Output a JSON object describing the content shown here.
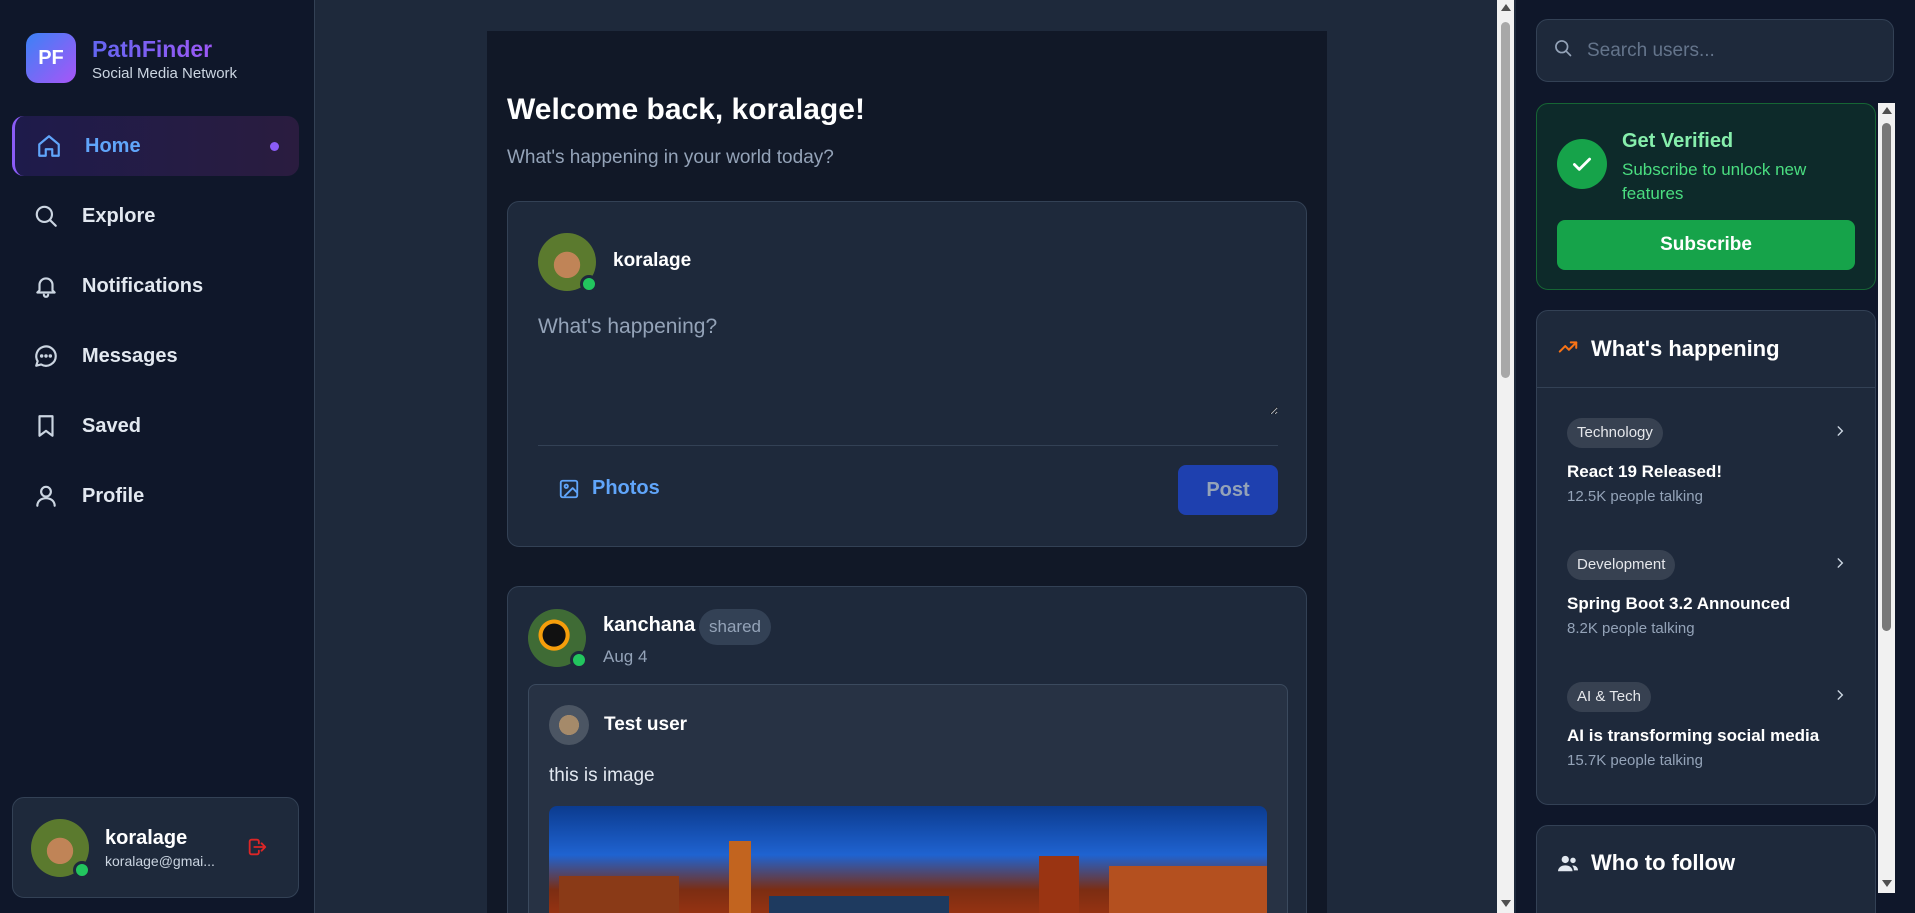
{
  "brand": {
    "logo": "PF",
    "name": "PathFinder",
    "tagline": "Social Media Network"
  },
  "nav": {
    "items": [
      {
        "label": "Home",
        "icon": "home-icon",
        "active": true
      },
      {
        "label": "Explore",
        "icon": "search-icon"
      },
      {
        "label": "Notifications",
        "icon": "bell-icon"
      },
      {
        "label": "Messages",
        "icon": "message-circle-icon"
      },
      {
        "label": "Saved",
        "icon": "bookmark-icon"
      },
      {
        "label": "Profile",
        "icon": "user-icon"
      }
    ]
  },
  "current_user": {
    "name": "koralage",
    "email": "koralage@gmai..."
  },
  "main": {
    "welcome": "Welcome back, koralage!",
    "welcome_sub": "What's happening in your world today?",
    "composer": {
      "username": "koralage",
      "placeholder": "What's happening?",
      "photos_label": "Photos",
      "post_label": "Post"
    },
    "post": {
      "author": "kanchana",
      "badge": "shared",
      "date": "Aug 4",
      "shared_post": {
        "author": "Test user",
        "text": "this is image"
      }
    }
  },
  "right": {
    "search_placeholder": "Search users...",
    "verify": {
      "title": "Get Verified",
      "subtitle": "Subscribe to unlock new features",
      "button": "Subscribe"
    },
    "trends": {
      "title": "What's happening",
      "items": [
        {
          "tag": "Technology",
          "title": "React 19 Released!",
          "meta": "12.5K people talking"
        },
        {
          "tag": "Development",
          "title": "Spring Boot 3.2 Announced",
          "meta": "8.2K people talking"
        },
        {
          "tag": "AI & Tech",
          "title": "AI is transforming social media",
          "meta": "15.7K people talking"
        }
      ]
    },
    "follow_title": "Who to follow"
  },
  "colors": {
    "accent": "#60a5fa",
    "brand_purple": "#8b5cf6",
    "success": "#16a34a",
    "online": "#22c55e",
    "trend_icon": "#f97316"
  }
}
